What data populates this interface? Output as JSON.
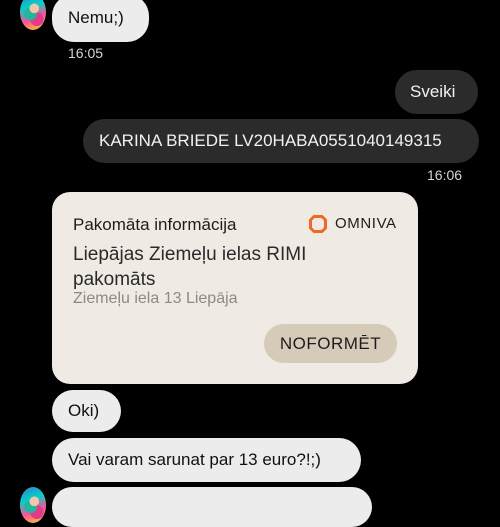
{
  "messages": {
    "m1_text": "Nemu;)",
    "m1_time": "16:05",
    "m2_text": "Sveiki",
    "m3_text": "KARINA BRIEDE LV20HABA0551040149315",
    "m3_time": "16:06",
    "m4_text": "Oki)",
    "m5_text": "Vai varam sarunat par 13 euro?!;)"
  },
  "card": {
    "heading": "Pakomāta informācija",
    "brand": "OMNIVA",
    "locker_name": "Liepājas Ziemeļu ielas RIMI pakomāts",
    "address": "Ziemeļu iela 13 Liepāja",
    "button_label": "NOFORMĒT"
  },
  "colors": {
    "background": "#000000",
    "incoming_bubble": "#ececec",
    "outgoing_bubble": "#2b2b2b",
    "card_background": "#efebe4",
    "card_button": "#d6cbb8",
    "omniva_orange": "#f26722"
  }
}
